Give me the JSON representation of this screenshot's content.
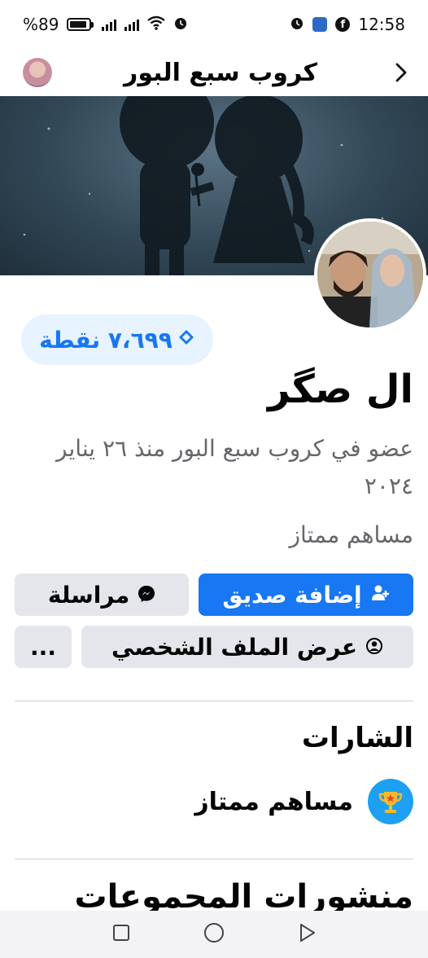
{
  "status_bar": {
    "battery_text": "%89",
    "battery_level": 0.89,
    "time": "12:58"
  },
  "header": {
    "title": "كروب سبع البور"
  },
  "profile": {
    "points": "٧،٦٩٩ نقطة",
    "name": "ال صگر",
    "member_since": "عضو في كروب سبع البور منذ ٢٦ يناير ٢٠٢٤",
    "role": "مساهم ممتاز"
  },
  "actions": {
    "add_friend": "إضافة صديق",
    "message": "مراسلة",
    "view_profile": "عرض الملف الشخصي",
    "more": "..."
  },
  "badges_section": {
    "title": "الشارات",
    "items": [
      {
        "label": "مساهم ممتاز",
        "icon": "trophy-icon"
      }
    ]
  },
  "posts_section": {
    "title": "منشورات المجموعات"
  },
  "colors": {
    "accent": "#1877f2",
    "secondary_button": "#e4e6eb",
    "muted_text": "#65676b"
  }
}
